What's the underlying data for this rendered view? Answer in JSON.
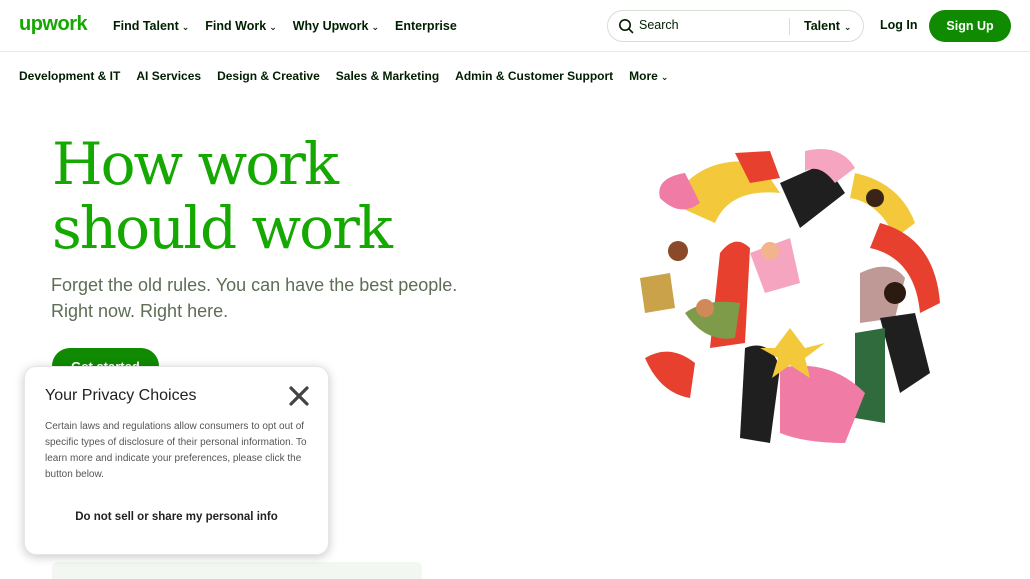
{
  "header": {
    "logo": "upwork",
    "nav": [
      {
        "label": "Find Talent",
        "chevron": true
      },
      {
        "label": "Find Work",
        "chevron": true
      },
      {
        "label": "Why Upwork",
        "chevron": true
      },
      {
        "label": "Enterprise",
        "chevron": false
      }
    ],
    "search": {
      "placeholder": "Search",
      "scope": "Talent"
    },
    "login": "Log In",
    "signup": "Sign Up"
  },
  "categories": [
    {
      "label": "Development & IT"
    },
    {
      "label": "AI Services"
    },
    {
      "label": "Design & Creative"
    },
    {
      "label": "Sales & Marketing"
    },
    {
      "label": "Admin & Customer Support"
    },
    {
      "label": "More",
      "chevron": true
    }
  ],
  "hero": {
    "title": "How work should work",
    "subtitle": "Forget the old rules. You can have the best people. Right now. Right here.",
    "cta": "Get started"
  },
  "privacy": {
    "title": "Your Privacy Choices",
    "body": "Certain laws and regulations allow consumers to opt out of specific types of disclosure of their personal information. To learn more and indicate your preferences, please click the button below.",
    "action": "Do not sell or share my personal info"
  },
  "colors": {
    "brand_green": "#14a800",
    "button_green": "#108a00",
    "text_dark": "#001e00",
    "subtitle_gray": "#5e6d55"
  }
}
